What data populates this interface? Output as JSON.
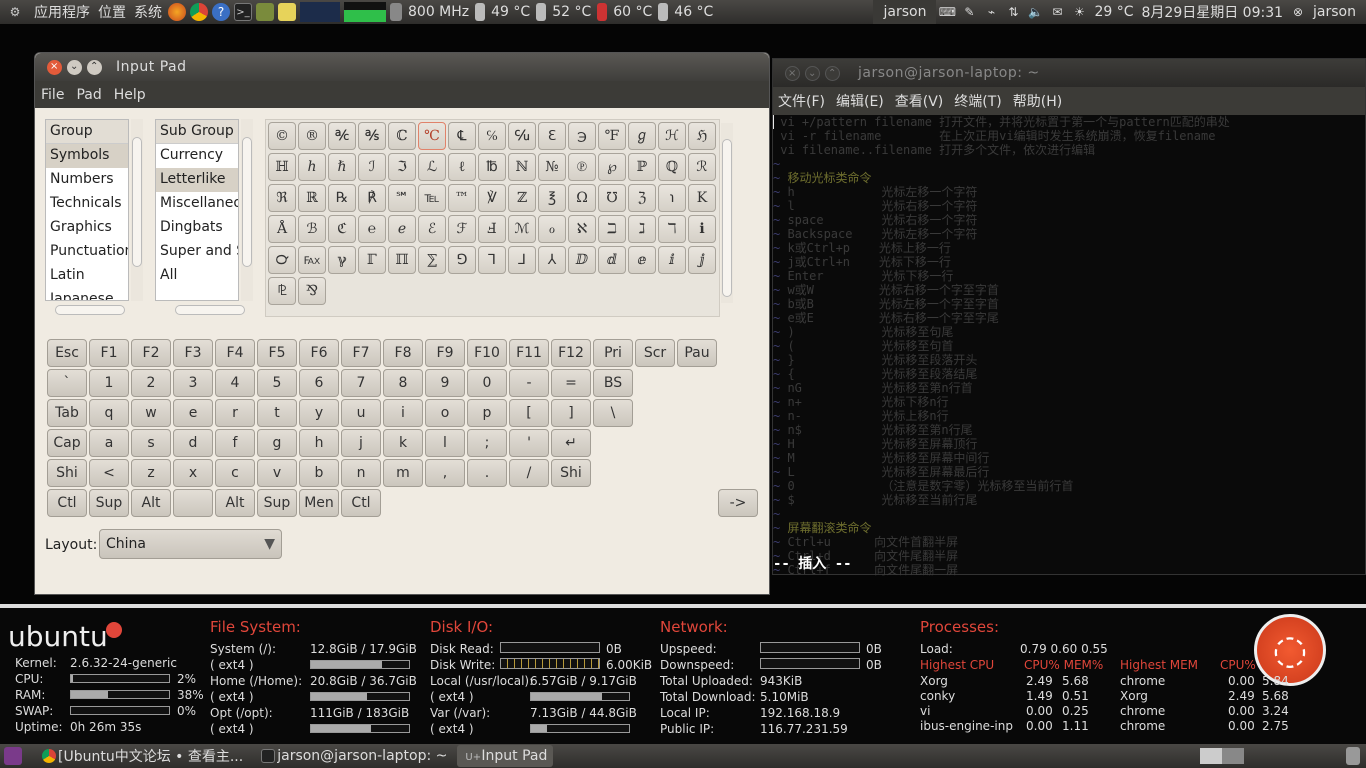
{
  "topbar": {
    "menus": [
      "应用程序",
      "位置",
      "系统"
    ],
    "cpu_freq": "800 MHz",
    "temps": [
      "49 °C",
      "52 °C",
      "60 °C",
      "46 °C"
    ],
    "user_label": "jarson",
    "weather": "29 °C",
    "datetime": "8月29日星期日 09:31",
    "session_user": "jarson"
  },
  "inputpad": {
    "title": "Input Pad",
    "menu": [
      "File",
      "Pad",
      "Help"
    ],
    "group_header": "Group",
    "groups": [
      "Symbols",
      "Numbers",
      "Technicals",
      "Graphics",
      "Punctuation",
      "Latin",
      "Japanese"
    ],
    "subgroup_header": "Sub Group",
    "subgroups": [
      "Currency",
      "Letterlike",
      "Miscellaneous",
      "Dingbats",
      "Super and Sub",
      "All"
    ],
    "chars": [
      [
        "©",
        "®",
        "℀",
        "℁",
        "ℂ",
        "℃",
        "℄",
        "℅",
        "℆",
        "ℇ",
        "℈",
        "℉",
        "ℊ",
        "ℋ",
        "ℌ"
      ],
      [
        "ℍ",
        "ℎ",
        "ℏ",
        "ℐ",
        "ℑ",
        "ℒ",
        "ℓ",
        "℔",
        "ℕ",
        "№",
        "℗",
        "℘",
        "ℙ",
        "ℚ",
        "ℛ"
      ],
      [
        "ℜ",
        "ℝ",
        "℞",
        "℟",
        "℠",
        "℡",
        "™",
        "℣",
        "ℤ",
        "℥",
        "Ω",
        "℧",
        "ℨ",
        "℩",
        "K"
      ],
      [
        "Å",
        "ℬ",
        "ℭ",
        "℮",
        "ℯ",
        "ℰ",
        "ℱ",
        "Ⅎ",
        "ℳ",
        "ℴ",
        "ℵ",
        "ℶ",
        "ℷ",
        "ℸ",
        "ℹ"
      ],
      [
        "℺",
        "℻",
        "ℽ",
        "ℾ",
        "ℿ",
        "⅀",
        "⅁",
        "⅂",
        "⅃",
        "⅄",
        "ⅅ",
        "ⅆ",
        "ⅇ",
        "ⅈ",
        "ⅉ"
      ],
      [
        "⅊",
        "⅋"
      ]
    ],
    "keyboard": [
      [
        "Esc",
        "F1",
        "F2",
        "F3",
        "F4",
        "F5",
        "F6",
        "F7",
        "F8",
        "F9",
        "F10",
        "F11",
        "F12",
        "Pri",
        "Scr",
        "Pau"
      ],
      [
        "`",
        "1",
        "2",
        "3",
        "4",
        "5",
        "6",
        "7",
        "8",
        "9",
        "0",
        "-",
        "=",
        "BS"
      ],
      [
        "Tab",
        "q",
        "w",
        "e",
        "r",
        "t",
        "y",
        "u",
        "i",
        "o",
        "p",
        "[",
        "]",
        "\\"
      ],
      [
        "Cap",
        "a",
        "s",
        "d",
        "f",
        "g",
        "h",
        "j",
        "k",
        "l",
        ";",
        "'",
        "↵"
      ],
      [
        "Shi",
        "<",
        "z",
        "x",
        "c",
        "v",
        "b",
        "n",
        "m",
        ",",
        ".",
        "/",
        "Shi"
      ],
      [
        "Ctl",
        "Sup",
        "Alt",
        "",
        "Alt",
        "Sup",
        "Men",
        "Ctl"
      ]
    ],
    "arrow_key": "->",
    "layout_label": "Layout:",
    "layout_value": "China"
  },
  "terminal": {
    "title": "jarson@jarson-laptop: ~",
    "menu": [
      "文件(F)",
      "编辑(E)",
      "查看(V)",
      "终端(T)",
      "帮助(H)"
    ],
    "lines": [
      "vi +/pattern filename 打开文件，并将光标置于第一个与pattern匹配的串处",
      "vi -r filename        在上次正用vi编辑时发生系统崩溃，恢复filename",
      "vi filename..filename 打开多个文件，依次进行编辑",
      "",
      "移动光标类命令",
      "h            光标左移一个字符",
      "l            光标右移一个字符",
      "space        光标右移一个字符",
      "Backspace    光标左移一个字符",
      "k或Ctrl+p    光标上移一行",
      "j或Ctrl+n    光标下移一行",
      "Enter        光标下移一行",
      "w或W         光标右移一个字至字首",
      "b或B         光标左移一个字至字首",
      "e或E         光标右移一个字至字尾",
      ")            光标移至句尾",
      "(            光标移至句首",
      "}            光标移至段落开头",
      "{            光标移至段落结尾",
      "nG           光标移至第n行首",
      "n+           光标下移n行",
      "n-           光标上移n行",
      "n$           光标移至第n行尾",
      "H            光标移至屏幕顶行",
      "M            光标移至屏幕中间行",
      "L            光标移至屏幕最后行",
      "0            （注意是数字零）光标移至当前行首",
      "$            光标移至当前行尾",
      "",
      "屏幕翻滚类命令",
      "Ctrl+u      向文件首翻半屏",
      "Ctrl+d      向文件尾翻半屏",
      "Ctrl+f      向文件尾翻一屏"
    ],
    "status": "-- 插入 --"
  },
  "conky": {
    "logo": "ubuntu",
    "kernel_label": "Kernel:",
    "kernel": "2.6.32-24-generic",
    "cpu_label": "CPU:",
    "cpu": "2%",
    "cpu_frac": 0.02,
    "ram_label": "RAM:",
    "ram": "38%",
    "ram_frac": 0.38,
    "swap_label": "SWAP:",
    "swap": "0%",
    "swap_frac": 0,
    "uptime_label": "Uptime:",
    "uptime": "0h 26m 35s",
    "fs_title": "File System:",
    "fs": [
      {
        "name": "System (/):",
        "type": "( ext4 )",
        "size": "12.8GiB / 17.9GiB",
        "frac": 0.72
      },
      {
        "name": "Home (/Home):",
        "type": "( ext4 )",
        "size": "20.8GiB / 36.7GiB",
        "frac": 0.57
      },
      {
        "name": "Opt (/opt):",
        "type": "( ext4 )",
        "size": "111GiB / 183GiB",
        "frac": 0.61
      }
    ],
    "disk_title": "Disk I/O:",
    "disk_read_label": "Disk Read:",
    "disk_read": "0B",
    "disk_write_label": "Disk Write:",
    "disk_write": "6.00KiB",
    "disk_fs": [
      {
        "name": "Local (/usr/local):",
        "type": "( ext4 )",
        "size": "6.57GiB / 9.17GiB",
        "frac": 0.72
      },
      {
        "name": "Var (/var):",
        "type": "( ext4 )",
        "size": "7.13GiB / 44.8GiB",
        "frac": 0.16
      }
    ],
    "net_title": "Network:",
    "up_label": "Upspeed:",
    "up": "0B",
    "down_label": "Downspeed:",
    "down": "0B",
    "tot_up_label": "Total Uploaded:",
    "tot_up": "943KiB",
    "tot_down_label": "Total Download:",
    "tot_down": "5.10MiB",
    "local_ip_label": "Local IP:",
    "local_ip": "192.168.18.9",
    "public_ip_label": "Public IP:",
    "public_ip": "116.77.231.59",
    "proc_title": "Processes:",
    "load_label": "Load:",
    "load": "0.79 0.60 0.55",
    "hi_cpu": "Highest CPU",
    "cpu_mem_hdr": "CPU% MEM%",
    "hi_mem": "Highest MEM",
    "cpu_mem_hdr2": "CPU% MEM%",
    "cpu_procs": [
      [
        "Xorg",
        "2.49",
        "5.68"
      ],
      [
        "conky",
        "1.49",
        "0.51"
      ],
      [
        "vi",
        "0.00",
        "0.25"
      ],
      [
        "ibus-engine-inp",
        "0.00",
        "1.11"
      ]
    ],
    "mem_procs": [
      [
        "chrome",
        "0.00",
        "5.84"
      ],
      [
        "Xorg",
        "2.49",
        "5.68"
      ],
      [
        "chrome",
        "0.00",
        "3.24"
      ],
      [
        "chrome",
        "0.00",
        "2.75"
      ]
    ]
  },
  "taskbar": {
    "tasks": [
      "[Ubuntu中文论坛 • 查看主...",
      "jarson@jarson-laptop: ~",
      "Input Pad"
    ]
  }
}
